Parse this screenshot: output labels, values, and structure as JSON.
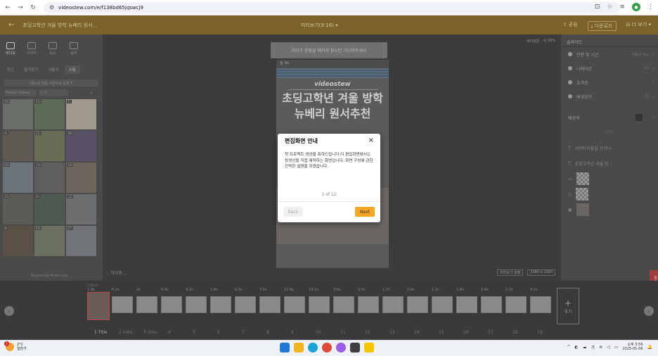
{
  "browser": {
    "url": "videostew.com/e/f138bd65jqswcj9"
  },
  "topbar": {
    "project_title": "초딩고학년 겨울 방학 뉴베리 원서...",
    "preview_title": "미리보기(9:16)",
    "share_label": "공유",
    "download_label": "다운로드",
    "more_label": "더 보기"
  },
  "leftpanel": {
    "modes": [
      {
        "label": "비디오"
      },
      {
        "label": "이미지"
      },
      {
        "label": "요소"
      },
      {
        "label": "음악"
      }
    ],
    "tabs": [
      "최근",
      "즐겨찾기",
      "서통지",
      "스톡"
    ],
    "text_search_label": "텍스트 내용 기반으로 검색",
    "source_label": "Pexels Videos",
    "search_placeholder": "검색",
    "thumb_durations": [
      "10s",
      "15s",
      "7s",
      "9s",
      "21s",
      "38s",
      "30s",
      "14s",
      "14s",
      "12s",
      "9s",
      "12s",
      "9s",
      "64s",
      "27s",
      "11s",
      "9s",
      "20s"
    ],
    "credit": "Powered by Pexels.com"
  },
  "canvas": {
    "notice": "처리가 완료될 때까지 잠시만 기다려주세요",
    "zoom_label": "Q 30%",
    "safe_zone": "세이프존",
    "preview_top": "0s",
    "brand": "videostew",
    "headline_line1": "초딩고학년 겨울 방학",
    "headline_line2": "뉴베리 원서추천",
    "loading": "처리중...",
    "resolution": "1080 x 1920",
    "bg_setting": "미리보기 설정"
  },
  "rightpanel": {
    "header": "슬라이드",
    "rows": [
      {
        "label": "전환 및 시간",
        "value": "자동(3.0s)"
      },
      {
        "label": "나레이션",
        "value": "0s"
      },
      {
        "label": "효과음",
        "value": ""
      },
      {
        "label": "배경음악",
        "value": "0"
      }
    ],
    "bgcolor_label": "배경색",
    "layers_label": "레이어",
    "text_layers": [
      "서브타이틀을 쓰거나..",
      "초딩고학년 겨울 방.."
    ],
    "side_tab": "피드백"
  },
  "timeline": {
    "total_time": "1:00:20",
    "clips": [
      {
        "num": "1 Title",
        "dur": "1.9s"
      },
      {
        "num": "2 intro",
        "dur": "0.2s"
      },
      {
        "num": "3 intro",
        "dur": "2s"
      },
      {
        "num": "4",
        "dur": "0.9s"
      },
      {
        "num": "5",
        "dur": "4.2s"
      },
      {
        "num": "6",
        "dur": "1.8s"
      },
      {
        "num": "7",
        "dur": "6.5s"
      },
      {
        "num": "8",
        "dur": "3.5s"
      },
      {
        "num": "9",
        "dur": "12.4s"
      },
      {
        "num": "10",
        "dur": "13.5s"
      },
      {
        "num": "11",
        "dur": "3.6s"
      },
      {
        "num": "12",
        "dur": "2.5s"
      },
      {
        "num": "13",
        "dur": "1.7s"
      },
      {
        "num": "14",
        "dur": "2.6s"
      },
      {
        "num": "15",
        "dur": "1.2s"
      },
      {
        "num": "16",
        "dur": "1.6s"
      },
      {
        "num": "17",
        "dur": "3.4s"
      },
      {
        "num": "18",
        "dur": "2.3s"
      },
      {
        "num": "19",
        "dur": "4.1s"
      }
    ],
    "add_label": "추가"
  },
  "modal": {
    "title": "편집화면 안내",
    "close": "×",
    "body": "첫 프로젝트 생성을 축하드립니다.이 편집화면에서는 동영상을 직접 제작하는 화면입니다. 화면 구성에 관한 간략한 설명을 하겠습니다.",
    "step": "1 of 12",
    "back_label": "Back",
    "next_label": "Next"
  },
  "taskbar": {
    "weather_badge": "1",
    "weather_temp": "2°C",
    "weather_desc": "일반가",
    "tray_lang": "가",
    "clock_time": "오후 3:56",
    "clock_date": "2025-01-06"
  },
  "colors": {
    "accent": "#f5a623",
    "topbar": "#7a6229"
  }
}
